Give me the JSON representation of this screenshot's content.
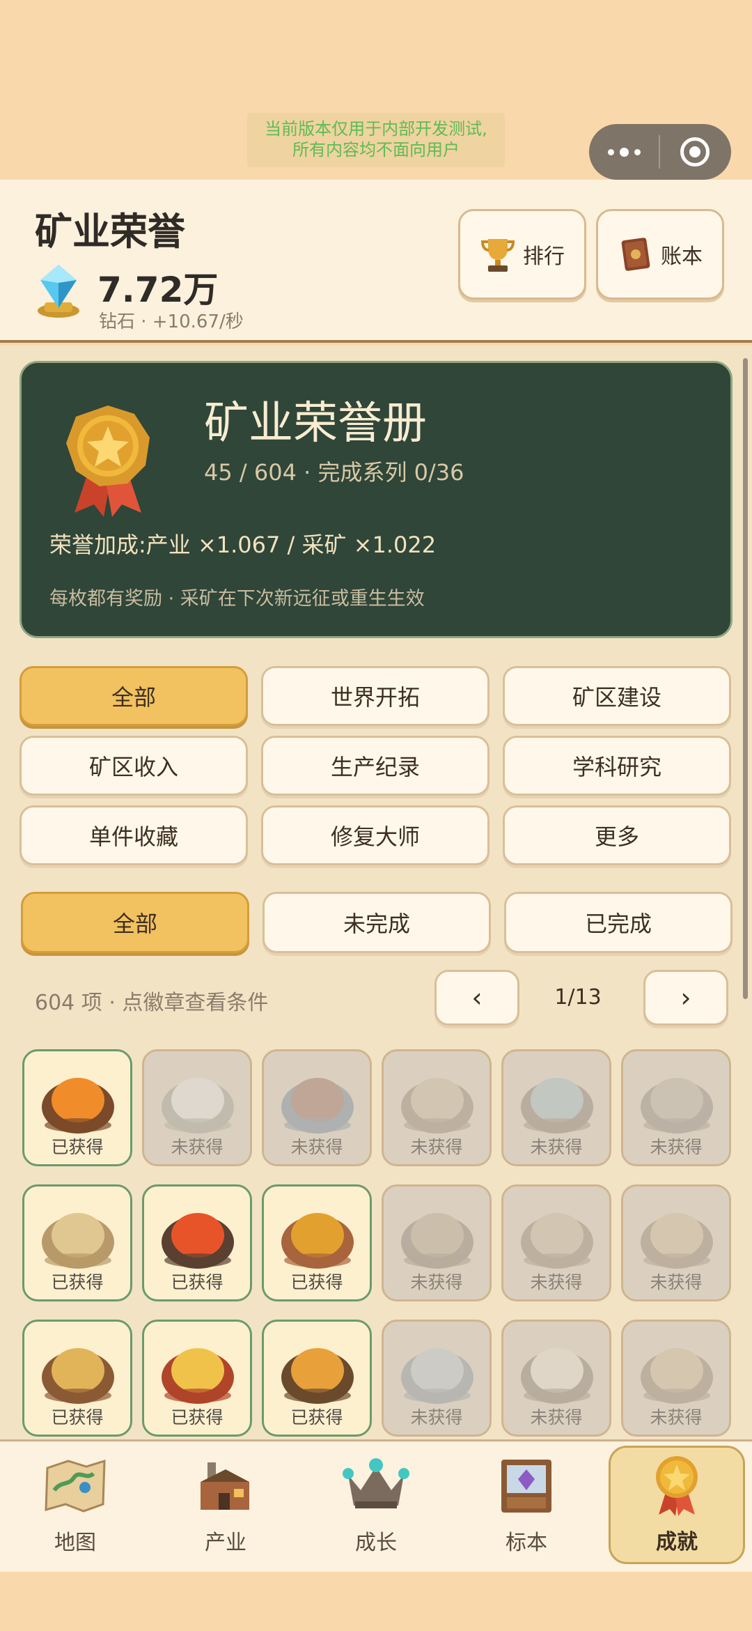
{
  "system": {
    "dev_notice_line1": "当前版本仅用于内部开发测试,",
    "dev_notice_line2": "所有内容均不面向用户",
    "menu_icon": "more-dots-icon",
    "close_icon": "target-circle-icon"
  },
  "header": {
    "title": "矿业荣誉",
    "diamond_value": "7.72万",
    "diamond_sub": "钻石 · +10.67/秒",
    "rank_button": "排行",
    "ledger_button": "账本"
  },
  "honor_card": {
    "title": "矿业荣誉册",
    "progress": "45 / 604 · 完成系列 0/36",
    "bonus": "荣誉加成:产业 ×1.067 / 采矿 ×1.022",
    "note": "每枚都有奖励 · 采矿在下次新远征或重生生效"
  },
  "categories": [
    "全部",
    "世界开拓",
    "矿区建设",
    "矿区收入",
    "生产纪录",
    "学科研究",
    "单件收藏",
    "修复大师",
    "更多"
  ],
  "status_filters": [
    "全部",
    "未完成",
    "已完成"
  ],
  "list": {
    "count_text": "604 项 · 点徽章查看条件",
    "prev": "‹",
    "next": "›",
    "page": "1/13"
  },
  "badges": [
    {
      "state": "已获得",
      "icon": "campfire-icon"
    },
    {
      "state": "未获得",
      "icon": "mountain-icon"
    },
    {
      "state": "未获得",
      "icon": "globe-flag-icon"
    },
    {
      "state": "未获得",
      "icon": "canyon-icon"
    },
    {
      "state": "未获得",
      "icon": "portal-icon"
    },
    {
      "state": "未获得",
      "icon": "tower-icon"
    },
    {
      "state": "已获得",
      "icon": "stone-wheel-icon"
    },
    {
      "state": "已获得",
      "icon": "volcano-icon"
    },
    {
      "state": "已获得",
      "icon": "gear-icon"
    },
    {
      "state": "未获得",
      "icon": "gears-icon"
    },
    {
      "state": "未获得",
      "icon": "ruins-icon"
    },
    {
      "state": "未获得",
      "icon": "castle-icon"
    },
    {
      "state": "已获得",
      "icon": "money-bag-icon"
    },
    {
      "state": "已获得",
      "icon": "treasure-chest-icon"
    },
    {
      "state": "已获得",
      "icon": "treasure-cave-icon"
    },
    {
      "state": "未获得",
      "icon": "crystal-icon"
    },
    {
      "state": "未获得",
      "icon": "clock-icon"
    },
    {
      "state": "未获得",
      "icon": "bell-icon"
    }
  ],
  "nav": {
    "map": "地图",
    "industry": "产业",
    "growth": "成长",
    "specimen": "标本",
    "achievement": "成就"
  }
}
